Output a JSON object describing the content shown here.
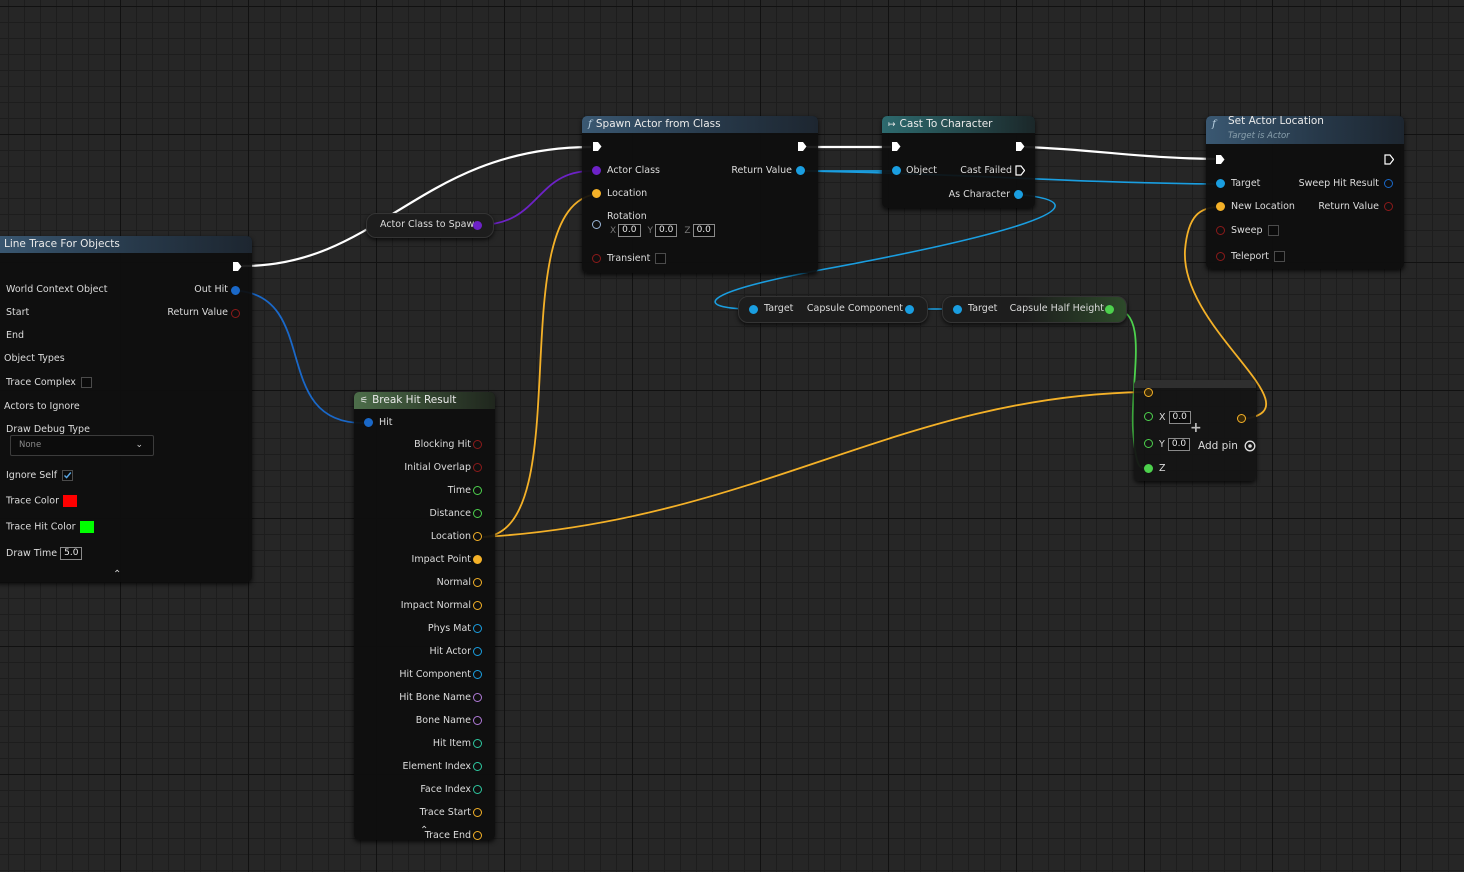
{
  "colors": {
    "exec": "#ffffff",
    "object": "#1a9ee0",
    "struct": "#f4b128",
    "class": "#6d22c7",
    "bool": "#8b1a1a",
    "float": "#4dd14d",
    "name": "#b07ad8",
    "int": "#2ec8a0",
    "trace_color": "#ff0000",
    "trace_hit_color": "#00ff00"
  },
  "line_trace": {
    "title": "Line Trace For Objects",
    "world_context": "World Context Object",
    "out_hit": "Out Hit",
    "start": "Start",
    "return_value": "Return Value",
    "end": "End",
    "object_types": "Object Types",
    "trace_complex": "Trace Complex",
    "actors_to_ignore": "Actors to Ignore",
    "draw_debug_type": "Draw Debug Type",
    "draw_debug_value": "None",
    "ignore_self": "Ignore Self",
    "trace_color": "Trace Color",
    "trace_hit_color": "Trace Hit Color",
    "draw_time": "Draw Time",
    "draw_time_value": "5.0"
  },
  "actor_class_pill": {
    "label": "Actor Class to Spawn"
  },
  "spawn": {
    "title": "Spawn Actor from Class",
    "actor_class": "Actor Class",
    "return_value": "Return Value",
    "location": "Location",
    "rotation": "Rotation",
    "x_label": "X",
    "y_label": "Y",
    "z_label": "Z",
    "x": "0.0",
    "y": "0.0",
    "z": "0.0",
    "transient": "Transient"
  },
  "cast": {
    "title": "Cast To Character",
    "object": "Object",
    "cast_failed": "Cast Failed",
    "as_character": "As Character"
  },
  "set_location": {
    "title": "Set Actor Location",
    "subtitle": "Target is Actor",
    "target": "Target",
    "sweep_hit_result": "Sweep Hit Result",
    "new_location": "New Location",
    "return_value": "Return Value",
    "sweep": "Sweep",
    "teleport": "Teleport"
  },
  "capsule_component": {
    "target": "Target",
    "output": "Capsule Component"
  },
  "capsule_half_height": {
    "target": "Target",
    "output": "Capsule Half Height"
  },
  "break_hit": {
    "title": "Break Hit Result",
    "hit": "Hit",
    "outputs": [
      {
        "label": "Blocking Hit",
        "type": "bool"
      },
      {
        "label": "Initial Overlap",
        "type": "bool"
      },
      {
        "label": "Time",
        "type": "float"
      },
      {
        "label": "Distance",
        "type": "float"
      },
      {
        "label": "Location",
        "type": "struct"
      },
      {
        "label": "Impact Point",
        "type": "struct"
      },
      {
        "label": "Normal",
        "type": "struct"
      },
      {
        "label": "Impact Normal",
        "type": "struct"
      },
      {
        "label": "Phys Mat",
        "type": "object"
      },
      {
        "label": "Hit Actor",
        "type": "object"
      },
      {
        "label": "Hit Component",
        "type": "object"
      },
      {
        "label": "Hit Bone Name",
        "type": "name"
      },
      {
        "label": "Bone Name",
        "type": "name"
      },
      {
        "label": "Hit Item",
        "type": "int"
      },
      {
        "label": "Element Index",
        "type": "int"
      },
      {
        "label": "Face Index",
        "type": "int"
      },
      {
        "label": "Trace Start",
        "type": "struct"
      },
      {
        "label": "Trace End",
        "type": "struct"
      }
    ]
  },
  "vector_add": {
    "x_label": "X",
    "x": "0.0",
    "y_label": "Y",
    "y": "0.0",
    "z_label": "Z",
    "add_pin": "Add pin"
  }
}
